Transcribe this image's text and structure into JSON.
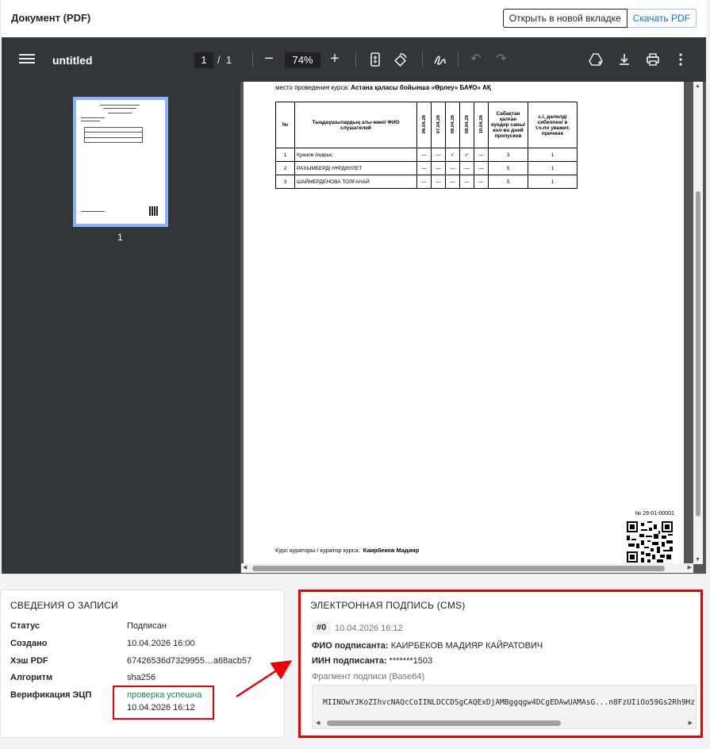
{
  "header": {
    "title": "Документ (PDF)",
    "open_new_tab": "Открыть в новой вкладке",
    "download_pdf": "Скачать PDF"
  },
  "viewer": {
    "doc_name": "untitled",
    "current_page": "1",
    "page_separator": "/",
    "total_pages": "1",
    "zoom": "74%",
    "thumb_page_label": "1",
    "icons": [
      "menu-icon",
      "zoom-out-icon",
      "zoom-in-icon",
      "fit-page-icon",
      "rotate-icon",
      "annotate-icon",
      "undo-icon",
      "redo-icon",
      "drive-icon",
      "download-icon",
      "print-icon",
      "more-icon"
    ]
  },
  "pdf_page": {
    "place_prefix": "место проведения курса:",
    "place_value": "Астана қаласы бойынша «Өрлеу» БАҰО» АҚ",
    "table": {
      "headers": [
        "№",
        "Тыңдаушылардың аты-жөні/ ФИО слушателей",
        "06.04.26",
        "07.04.26",
        "08.04.26",
        "09.04.26",
        "10.04.26",
        "Сабақтан қалған күндер саны/ кол-во дней пропусков",
        "с.і. дәлелді себеппен/ в т.ч.по уважит. причине"
      ],
      "rows": [
        [
          "1",
          "Қуанов Ақарыс",
          "—",
          "—",
          "✓",
          "✓",
          "—",
          "3",
          "1"
        ],
        [
          "2",
          "РАХЫМБЕРДІ НҰРДӘУЛЕТ",
          "—",
          "—",
          "—",
          "—",
          "—",
          "5",
          "1"
        ],
        [
          "3",
          "ШАЙМЕРДЕНОВА ТОЛҒАНАЙ",
          "—",
          "—",
          "—",
          "—",
          "—",
          "5",
          "1"
        ]
      ]
    },
    "doc_number": "№ 26-01-00001",
    "curator_label": "Курс кураторы / куратор курса:",
    "curator_name": "Каирбеков Мадияр"
  },
  "record_info": {
    "title": "СВЕДЕНИЯ О ЗАПИСИ",
    "rows": [
      {
        "label": "Статус",
        "value": "Подписан"
      },
      {
        "label": "Создано",
        "value": "10.04.2026 16:00"
      },
      {
        "label": "Хэш PDF",
        "value": "67426536d7329955…a68acb57"
      },
      {
        "label": "Алгоритм",
        "value": "sha256"
      },
      {
        "label": "Верификация ЭЦП",
        "value": "проверка успешна",
        "value2": "10.04.2026 16:12"
      }
    ]
  },
  "signature": {
    "title": "ЭЛЕКТРОННАЯ ПОДПИСЬ (CMS)",
    "index": "#0",
    "date": "10.04.2026 16:12",
    "signer_label": "ФИО подписанта:",
    "signer_name": "КАИРБЕКОВ МАДИЯР КАЙРАТОВИЧ",
    "iin_label": "ИИН подписанта:",
    "iin_value": "*******1503",
    "fragment_label": "Фрагмент подписи (Base64)",
    "fragment": "MIINOwYJKoZIhvcNAQcCoIINLDCCDSgCAQExDjAMBggqgw4DCgEDAwUAMAsG...n8FzUIiOo59Gs2Rh9Hz"
  },
  "colors": {
    "success": "#198754",
    "highlight": "#ee0000",
    "toolbar": "#323639",
    "primary": "#0d6efd"
  }
}
